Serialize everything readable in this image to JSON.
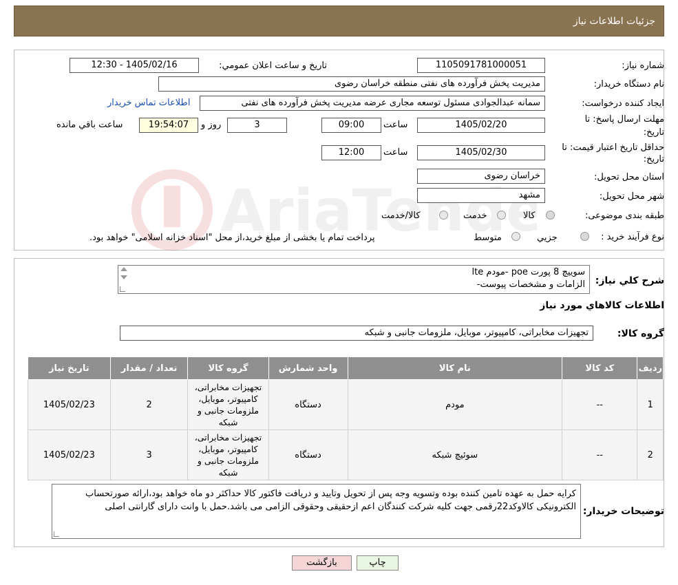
{
  "header": {
    "title": "جزئیات اطلاعات نیاز"
  },
  "form": {
    "need_number_label": "شماره نیاز:",
    "need_number": "1105091781000051",
    "announce_label": "تاریخ و ساعت اعلان عمومي:",
    "announce_value": "1405/02/16 - 12:30",
    "buyer_org_label": "نام دستگاه خريدار:",
    "buyer_org": "مدیریت پخش فرآورده های نفتی منطقه خراسان رضوی",
    "creator_label": "ايجاد کننده درخواست:",
    "creator": "سمانه عبدالجوادی مسئول توسعه مجاری عرضه مدیریت پخش فرآورده های نفتی",
    "contact_link": "اطلاعات تماس خريدار",
    "deadline_label_1": "مهلت ارسال پاسخ: تا",
    "deadline_label_2": "تاريخ:",
    "deadline_date": "1405/02/20",
    "time_label": "ساعت",
    "deadline_time": "09:00",
    "days_value": "3",
    "days_label": "روز و",
    "remaining_time": "19:54:07",
    "remaining_label": "ساعت باقي مانده",
    "validity_label_1": "حداقل تاريخ اعتبار قيمت: تا",
    "validity_label_2": "تاريخ:",
    "validity_date": "1405/02/30",
    "validity_time": "12:00",
    "province_label": "استان محل تحويل:",
    "province": "خراسان رضوی",
    "city_label": "شهر محل تحويل:",
    "city": "مشهد",
    "category_label": "طبقه بندی موضوعی:",
    "category_options": [
      "کالا",
      "خدمت",
      "کالا/خدمت"
    ],
    "process_label": "نوع فرآيند خريد :",
    "process_options": [
      "جزيي",
      "متوسط"
    ],
    "process_note": "پرداخت تمام يا بخشی از مبلغ خريد،از محل \"اسناد خزانه اسلامی\" خواهد بود."
  },
  "summary": {
    "label": "شرح کلي نياز:",
    "line1": "سوییچ 8 پورت poe -مودم lte",
    "line2": "الزامات و مشخصات پیوست-"
  },
  "goods": {
    "section_title": "اطلاعات کالاهاي مورد نياز",
    "group_label": "گروه کالا:",
    "group_value": "تجهیزات مخابراتی، کامپیوتر، موبایل، ملزومات جانبی و شبکه"
  },
  "table": {
    "headers": [
      "رديف",
      "کد کالا",
      "نام کالا",
      "واحد شمارش",
      "گروه کالا",
      "تعداد / مقدار",
      "تاريخ نياز"
    ],
    "rows": [
      {
        "row": "1",
        "code": "--",
        "name": "مودم",
        "unit": "دستگاه",
        "group": "تجهیزات مخابراتی، کامپیوتر، موبایل، ملزومات جانبی و شبکه",
        "qty": "2",
        "date": "1405/02/23"
      },
      {
        "row": "2",
        "code": "--",
        "name": "سوئیچ شبکه",
        "unit": "دستگاه",
        "group": "تجهیزات مخابراتی، کامپیوتر، موبایل، ملزومات جانبی و شبکه",
        "qty": "3",
        "date": "1405/02/23"
      }
    ]
  },
  "notes": {
    "label": "توضيحات خريدار:",
    "text": "کرایه حمل به عهده تامین کننده بوده وتسویه وجه پس از تحویل وتایید و دریافت فاکتور کالا حداکثر دو ماه خواهد بود،ارائه صورتحساب الکترونیکی کالاوکد22رقمی جهت کلیه شرکت کنندگان اعم ازحقیقی وحقوقی الزامی می باشد.حمل با وانت دارای گارانتی اصلی"
  },
  "buttons": {
    "print": "چاپ",
    "back": "بازگشت"
  },
  "colors": {
    "header": "#8a7350",
    "table_header": "#8f8f8f",
    "back_button": "#f5d5d5",
    "print_button": "#e8f5e0"
  }
}
